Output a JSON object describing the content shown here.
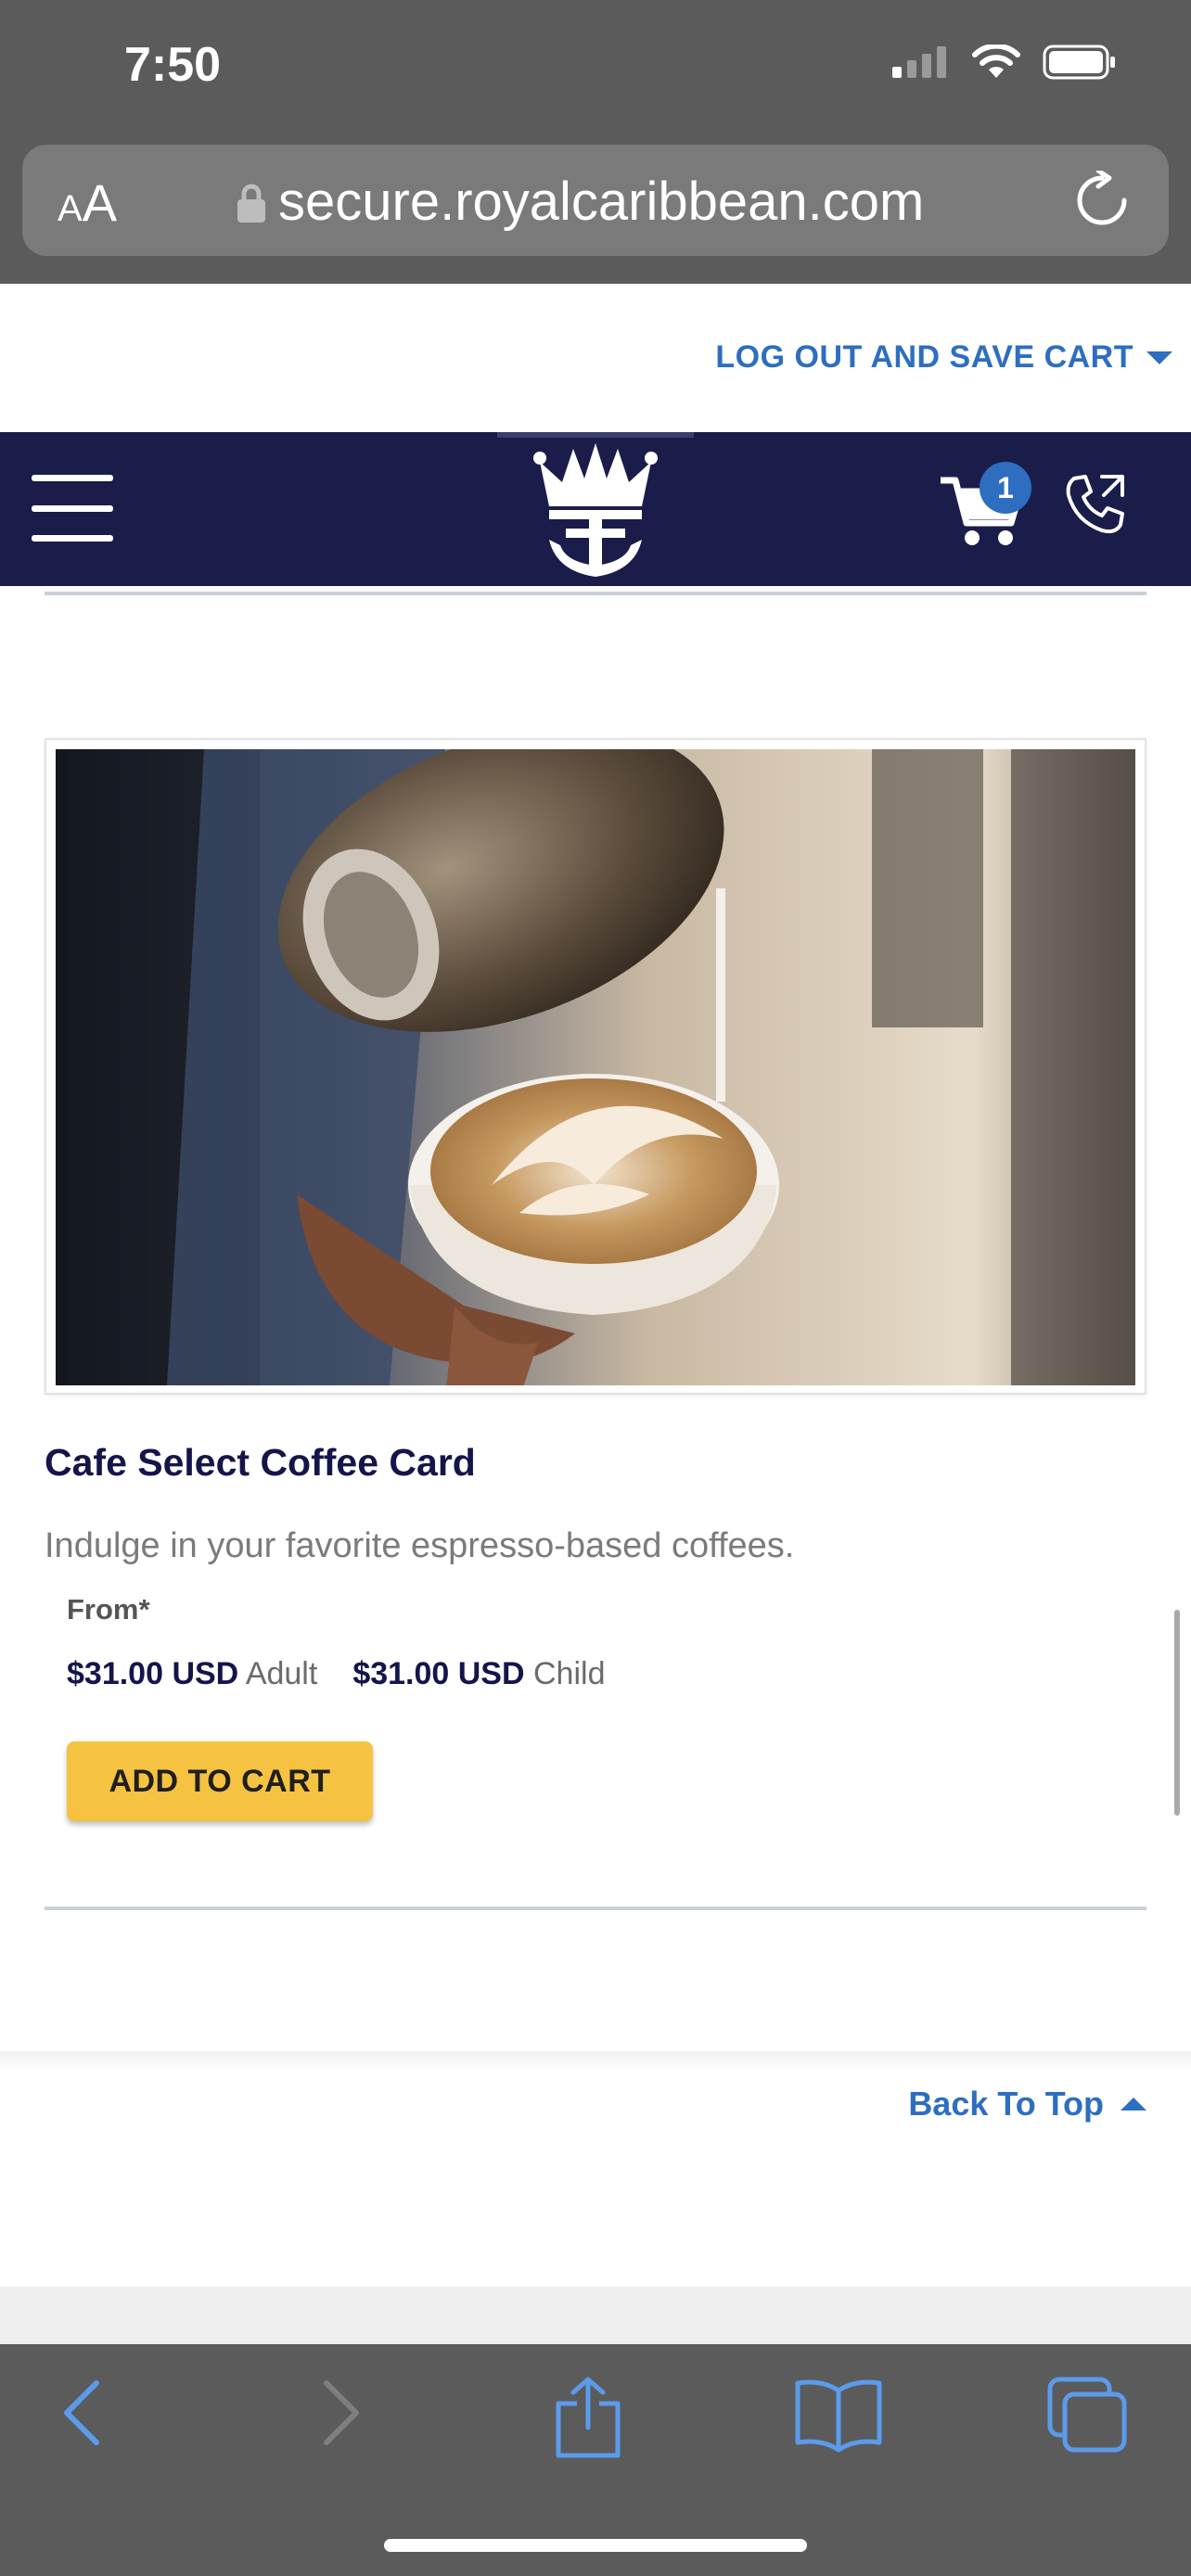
{
  "status_bar": {
    "time": "7:50"
  },
  "browser": {
    "text_size_label_small": "A",
    "text_size_label_large": "A",
    "url": "secure.royalcaribbean.com"
  },
  "page": {
    "logout_link": "LOG OUT AND SAVE CART",
    "cart_count": "1",
    "product": {
      "title": "Cafe Select Coffee Card",
      "description": "Indulge in your favorite espresso-based coffees.",
      "from_label": "From*",
      "prices": [
        {
          "amount": "$31.00 USD",
          "label": "Adult"
        },
        {
          "amount": "$31.00 USD",
          "label": "Child"
        }
      ],
      "add_to_cart": "ADD TO CART"
    },
    "back_to_top": "Back To Top"
  },
  "colors": {
    "navy": "#1a1d4a",
    "link_blue": "#2d6ec1",
    "button_yellow": "#f5c242"
  },
  "icons": [
    "signal-icon",
    "wifi-icon",
    "battery-icon",
    "lock-icon",
    "reload-icon",
    "menu-icon",
    "royal-caribbean-crown-logo",
    "cart-icon",
    "phone-icon",
    "back-icon",
    "forward-icon",
    "share-icon",
    "bookmarks-icon",
    "tabs-icon"
  ]
}
